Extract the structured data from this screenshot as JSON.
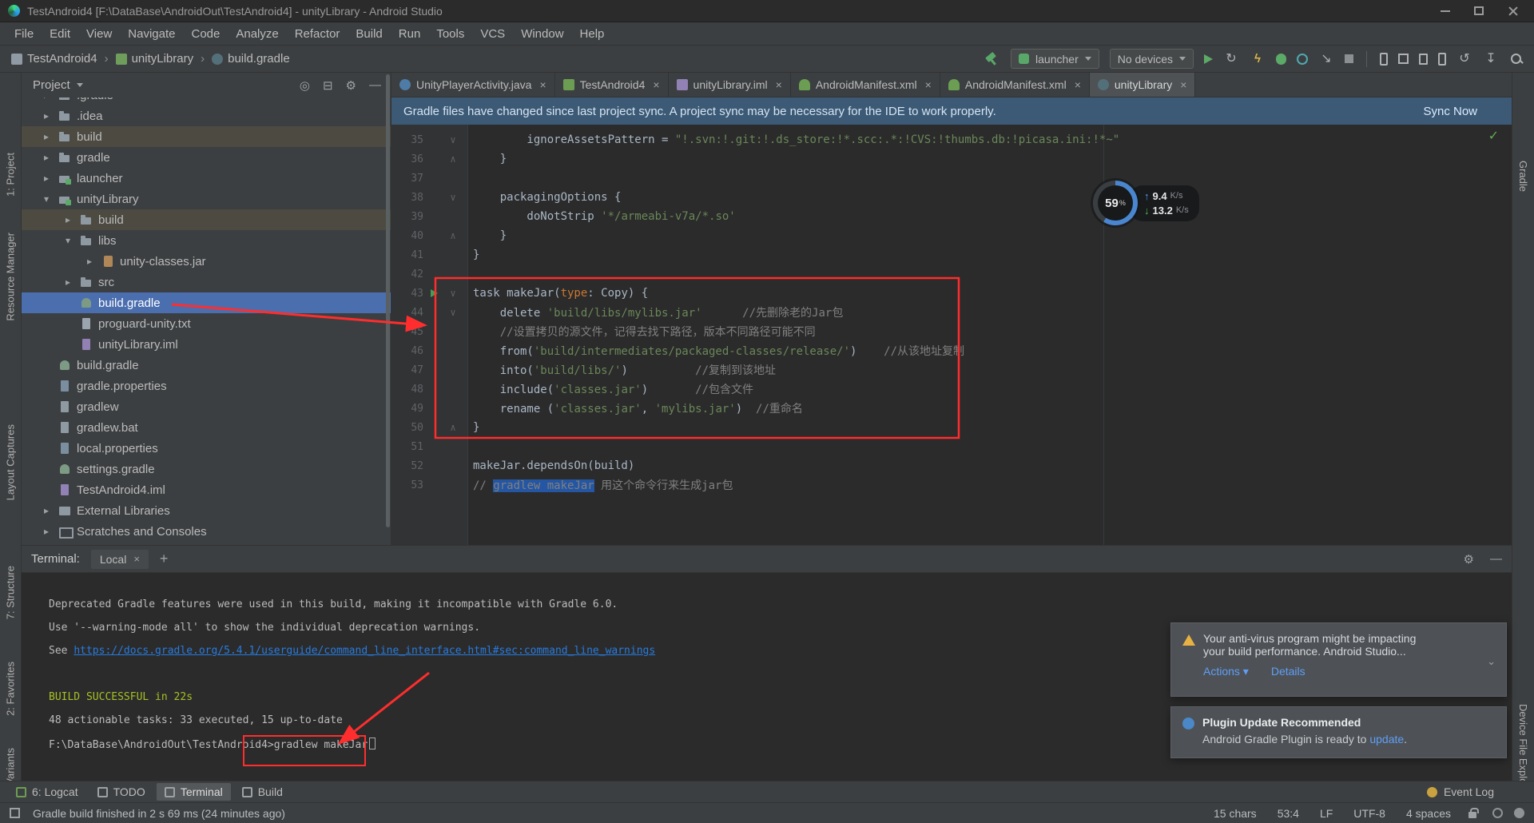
{
  "colors": {
    "annotation_red": "#ff2d2d",
    "tree_selection_blue": "#4b6eaf",
    "editor_selection_blue": "#2456a3",
    "banner_blue": "#3c5a76",
    "string_green": "#6a8759",
    "comment_gray": "#808080",
    "keyword_orange": "#cc7832",
    "terminal_success_green": "#a8c023",
    "terminal_link_blue": "#287bde"
  },
  "title_bar": {
    "title": "TestAndroid4 [F:\\DataBase\\AndroidOut\\TestAndroid4] - unityLibrary - Android Studio"
  },
  "menu_bar": [
    "File",
    "Edit",
    "View",
    "Navigate",
    "Code",
    "Analyze",
    "Refactor",
    "Build",
    "Run",
    "Tools",
    "VCS",
    "Window",
    "Help"
  ],
  "toolbar": {
    "breadcrumb": [
      {
        "label": "TestAndroid4",
        "icon": "project-icon"
      },
      {
        "label": "unityLibrary",
        "icon": "module-icon"
      },
      {
        "label": "build.gradle",
        "icon": "gradle-file-icon"
      }
    ],
    "run_config": "launcher",
    "device_selector": "No devices",
    "actions": [
      {
        "name": "run-button",
        "kind": "run"
      },
      {
        "name": "apply-changes-button",
        "kind": "refresh"
      },
      {
        "name": "apply-code-changes-button",
        "kind": "bolt"
      },
      {
        "name": "debug-button",
        "kind": "bug"
      },
      {
        "name": "profile-button",
        "kind": "profile"
      },
      {
        "name": "attach-debugger-button",
        "kind": "attach"
      },
      {
        "name": "stop-button",
        "kind": "stop"
      }
    ],
    "tools": [
      {
        "name": "device-manager-button",
        "kind": "phone"
      },
      {
        "name": "layout-inspector-button",
        "kind": "grid"
      },
      {
        "name": "analyze-apk-button",
        "kind": "file"
      },
      {
        "name": "avd-manager-button",
        "kind": "phone"
      },
      {
        "name": "sync-project-button",
        "kind": "sync"
      },
      {
        "name": "sdk-manager-button",
        "kind": "download"
      },
      {
        "name": "search-everywhere-button",
        "kind": "search"
      }
    ]
  },
  "tool_stripes": {
    "left": [
      "1: Project",
      "Resource Manager",
      "Layout Captures",
      "7: Structure",
      "2: Favorites",
      "Build Variants"
    ],
    "right": [
      "Gradle",
      "Device File Explorer"
    ]
  },
  "project_panel": {
    "title": "Project",
    "tree": [
      {
        "label": ".gradle",
        "icon": "folder",
        "level": 0,
        "arrow": "collapsed",
        "partial": true
      },
      {
        "label": ".idea",
        "icon": "folder",
        "level": 0,
        "arrow": "collapsed"
      },
      {
        "label": "build",
        "icon": "folder",
        "level": 0,
        "arrow": "collapsed",
        "rowstyle": "excluded"
      },
      {
        "label": "gradle",
        "icon": "folder",
        "level": 0,
        "arrow": "collapsed"
      },
      {
        "label": "launcher",
        "icon": "module",
        "level": 0,
        "arrow": "collapsed"
      },
      {
        "label": "unityLibrary",
        "icon": "module",
        "level": 0,
        "arrow": "expanded"
      },
      {
        "label": "build",
        "icon": "folder",
        "level": 1,
        "arrow": "collapsed",
        "rowstyle": "excluded"
      },
      {
        "label": "libs",
        "icon": "folder",
        "level": 1,
        "arrow": "expanded"
      },
      {
        "label": "unity-classes.jar",
        "icon": "jar",
        "level": 2,
        "arrow": "collapsed"
      },
      {
        "label": "src",
        "icon": "folder",
        "level": 1,
        "arrow": "collapsed"
      },
      {
        "label": "build.gradle",
        "icon": "gradle",
        "level": 1,
        "selected": true
      },
      {
        "label": "proguard-unity.txt",
        "icon": "text",
        "level": 1
      },
      {
        "label": "unityLibrary.iml",
        "icon": "iml",
        "level": 1
      },
      {
        "label": "build.gradle",
        "icon": "gradle",
        "level": 0
      },
      {
        "label": "gradle.properties",
        "icon": "properties",
        "level": 0
      },
      {
        "label": "gradlew",
        "icon": "file",
        "level": 0
      },
      {
        "label": "gradlew.bat",
        "icon": "file",
        "level": 0
      },
      {
        "label": "local.properties",
        "icon": "properties",
        "level": 0
      },
      {
        "label": "settings.gradle",
        "icon": "gradle",
        "level": 0
      },
      {
        "label": "TestAndroid4.iml",
        "icon": "iml",
        "level": 0
      },
      {
        "label": "External Libraries",
        "icon": "libraries",
        "level": 0,
        "arrow": "collapsed"
      },
      {
        "label": "Scratches and Consoles",
        "icon": "scratches",
        "level": 0,
        "arrow": "collapsed"
      }
    ]
  },
  "editor": {
    "tabs": [
      {
        "label": "UnityPlayerActivity.java",
        "icon": "java-class-icon"
      },
      {
        "label": "TestAndroid4",
        "icon": "android-module-icon"
      },
      {
        "label": "unityLibrary.iml",
        "icon": "iml-file-icon"
      },
      {
        "label": "AndroidManifest.xml",
        "icon": "manifest-file-icon"
      },
      {
        "label": "AndroidManifest.xml",
        "icon": "manifest-file-icon"
      },
      {
        "label": "unityLibrary",
        "icon": "gradle-file-icon2",
        "active": true
      }
    ],
    "banner": {
      "message": "Gradle files have changed since last project sync. A project sync may be necessary for the IDE to work properly.",
      "action": "Sync Now"
    },
    "code_lines": [
      {
        "num": 35,
        "fold": "down",
        "segments": [
          {
            "t": "        ignoreAssetsPattern = ",
            "c": "plain"
          },
          {
            "t": "\"!.svn:!.git:!.ds_store:!*.scc:.*:!CVS:!thumbs.db:!picasa.ini:!*~\"",
            "c": "string"
          }
        ]
      },
      {
        "num": 36,
        "fold": "up",
        "segments": [
          {
            "t": "    }",
            "c": "plain"
          }
        ]
      },
      {
        "num": 37,
        "segments": []
      },
      {
        "num": 38,
        "fold": "down",
        "segments": [
          {
            "t": "    packagingOptions {",
            "c": "plain"
          }
        ]
      },
      {
        "num": 39,
        "segments": [
          {
            "t": "        doNotStrip ",
            "c": "plain"
          },
          {
            "t": "'*/armeabi-v7a/*.so'",
            "c": "string"
          }
        ]
      },
      {
        "num": 40,
        "fold": "up",
        "segments": [
          {
            "t": "    }",
            "c": "plain"
          }
        ]
      },
      {
        "num": 41,
        "segments": [
          {
            "t": "}",
            "c": "plain"
          }
        ]
      },
      {
        "num": 42,
        "segments": []
      },
      {
        "num": 43,
        "run": true,
        "fold": "down",
        "segments": [
          {
            "t": "task makeJar(",
            "c": "plain"
          },
          {
            "t": "type",
            "c": "keyword"
          },
          {
            "t": ": Copy) {",
            "c": "plain"
          }
        ]
      },
      {
        "num": 44,
        "fold": "down",
        "segments": [
          {
            "t": "    delete ",
            "c": "plain"
          },
          {
            "t": "'build/libs/mylibs.jar'",
            "c": "string"
          },
          {
            "t": "      ",
            "c": "plain"
          },
          {
            "t": "//先删除老的Jar包",
            "c": "comment"
          }
        ]
      },
      {
        "num": 45,
        "segments": [
          {
            "t": "    ",
            "c": "plain"
          },
          {
            "t": "//设置拷贝的源文件，记得去找下路径，版本不同路径可能不同",
            "c": "comment"
          }
        ]
      },
      {
        "num": 46,
        "segments": [
          {
            "t": "    from(",
            "c": "plain"
          },
          {
            "t": "'build/intermediates/packaged-classes/release/'",
            "c": "string"
          },
          {
            "t": ")    ",
            "c": "plain"
          },
          {
            "t": "//从该地址复制",
            "c": "comment"
          }
        ]
      },
      {
        "num": 47,
        "segments": [
          {
            "t": "    into(",
            "c": "plain"
          },
          {
            "t": "'build/libs/'",
            "c": "string"
          },
          {
            "t": ")          ",
            "c": "plain"
          },
          {
            "t": "//复制到该地址",
            "c": "comment"
          }
        ]
      },
      {
        "num": 48,
        "segments": [
          {
            "t": "    include(",
            "c": "plain"
          },
          {
            "t": "'classes.jar'",
            "c": "string"
          },
          {
            "t": ")       ",
            "c": "plain"
          },
          {
            "t": "//包含文件",
            "c": "comment"
          }
        ]
      },
      {
        "num": 49,
        "segments": [
          {
            "t": "    rename (",
            "c": "plain"
          },
          {
            "t": "'classes.jar'",
            "c": "string"
          },
          {
            "t": ", ",
            "c": "plain"
          },
          {
            "t": "'mylibs.jar'",
            "c": "string"
          },
          {
            "t": ")  ",
            "c": "plain"
          },
          {
            "t": "//重命名",
            "c": "comment"
          }
        ]
      },
      {
        "num": 50,
        "fold": "up",
        "segments": [
          {
            "t": "}",
            "c": "plain"
          }
        ]
      },
      {
        "num": 51,
        "segments": []
      },
      {
        "num": 52,
        "segments": [
          {
            "t": "makeJar.dependsOn(build)",
            "c": "plain"
          }
        ]
      },
      {
        "num": 53,
        "segments": [
          {
            "t": "// ",
            "c": "comment"
          },
          {
            "t": "gradlew makeJar",
            "c": "comment selected"
          },
          {
            "t": " 用这个命令行来生成jar包",
            "c": "comment"
          }
        ]
      }
    ]
  },
  "perf_widget": {
    "cpu": "59",
    "cpu_unit": "%",
    "upload": "9.4",
    "download": "13.2",
    "unit": "K/s"
  },
  "terminal": {
    "label": "Terminal:",
    "tab": "Local",
    "lines": [
      {
        "segments": [
          {
            "t": "Deprecated Gradle features were used in this build, making it incompatible with Gradle 6.0.",
            "c": "plain"
          }
        ]
      },
      {
        "segments": [
          {
            "t": "Use '--warning-mode all' to show the individual deprecation warnings.",
            "c": "plain"
          }
        ]
      },
      {
        "segments": [
          {
            "t": "See ",
            "c": "plain"
          },
          {
            "t": "https://docs.gradle.org/5.4.1/userguide/command_line_interface.html#sec:command_line_warnings",
            "c": "link"
          }
        ]
      },
      {
        "segments": []
      },
      {
        "segments": [
          {
            "t": "BUILD SUCCESSFUL",
            "c": "success"
          },
          {
            "t": " in 22s",
            "c": "success"
          }
        ]
      },
      {
        "segments": [
          {
            "t": "48 actionable tasks: 33 executed, 15 up-to-date",
            "c": "plain"
          }
        ]
      },
      {
        "segments": [
          {
            "t": "F:\\DataBase\\AndroidOut\\TestAndroid4>",
            "c": "plain"
          },
          {
            "t": "gradlew makeJar",
            "c": "plain"
          }
        ],
        "cursor": true
      }
    ]
  },
  "notifications": {
    "antivirus": {
      "line1": "Your anti-virus program might be impacting",
      "line2": "your build performance. Android Studio...",
      "actions_label": "Actions",
      "details_label": "Details"
    },
    "plugin": {
      "title": "Plugin Update Recommended",
      "text_prefix": "Android Gradle Plugin is ready to ",
      "link": "update",
      "text_suffix": "."
    }
  },
  "bottom_bar": {
    "items": [
      {
        "label": "6: Logcat",
        "icon": "logcat-icon"
      },
      {
        "label": "TODO",
        "icon": "todo-icon"
      },
      {
        "label": "Terminal",
        "icon": "terminal-icon",
        "active": true
      },
      {
        "label": "Build",
        "icon": "build-icon"
      }
    ],
    "event_log": "Event Log"
  },
  "status_bar": {
    "message": "Gradle build finished in 2 s 69 ms (24 minutes ago)",
    "items": [
      "15 chars",
      "53:4",
      "LF",
      "UTF-8",
      "4 spaces"
    ]
  }
}
